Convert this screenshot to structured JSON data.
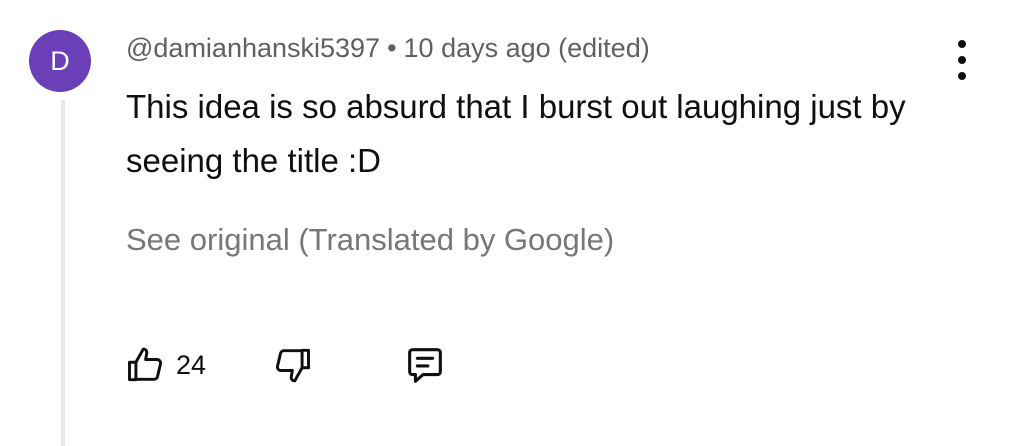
{
  "comment": {
    "avatar_letter": "D",
    "avatar_color": "#6b3fb8",
    "author": "@damianhanski5397",
    "separator": "•",
    "timestamp": "10 days ago (edited)",
    "text": "This idea is so absurd that I burst out laughing just by seeing the title :D",
    "translation_link": "See original (Translated by Google)",
    "like_count": "24"
  },
  "icons": {
    "menu": "more-vertical-icon",
    "like": "thumbs-up-icon",
    "dislike": "thumbs-down-icon",
    "reply": "reply-comment-icon"
  }
}
